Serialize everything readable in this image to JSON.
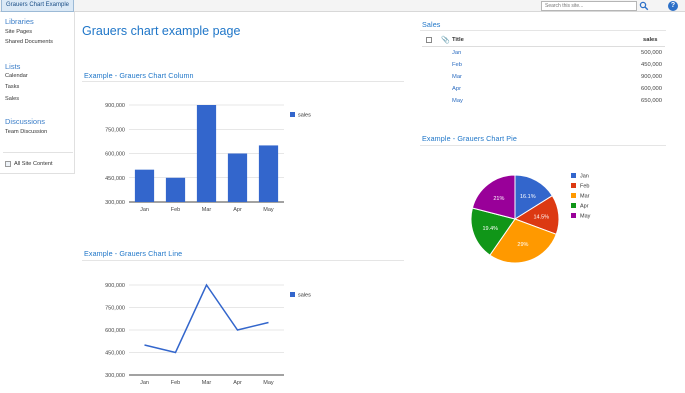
{
  "topbar": {
    "site_tab": "Grauers Chart Example",
    "search_placeholder": "Search this site..."
  },
  "leftnav": {
    "libraries_heading": "Libraries",
    "libraries": [
      "Site Pages",
      "Shared Documents"
    ],
    "lists_heading": "Lists",
    "lists": [
      "Calendar",
      "Tasks",
      "Sales"
    ],
    "discussions_heading": "Discussions",
    "discussions": [
      "Team Discussion"
    ],
    "all_content": "All Site Content"
  },
  "page_title": "Grauers chart example page",
  "sections": {
    "column_title": "Example - Grauers Chart Column",
    "line_title": "Example - Grauers Chart Line",
    "sales_title": "Sales",
    "pie_title": "Example - Grauers Chart Pie"
  },
  "sales_list": {
    "columns": {
      "title": "Title",
      "sales": "sales"
    },
    "rows": [
      {
        "title": "Jan",
        "sales": "500,000"
      },
      {
        "title": "Feb",
        "sales": "450,000"
      },
      {
        "title": "Mar",
        "sales": "900,000"
      },
      {
        "title": "Apr",
        "sales": "600,000"
      },
      {
        "title": "May",
        "sales": "650,000"
      }
    ]
  },
  "colors": {
    "accent": "#1f76c8",
    "series": "#3366cc",
    "pie": [
      "#3366cc",
      "#dc3912",
      "#ff9900",
      "#109618",
      "#990099"
    ]
  },
  "chart_data": [
    {
      "type": "bar",
      "categories": [
        "Jan",
        "Feb",
        "Mar",
        "Apr",
        "May"
      ],
      "series": [
        {
          "name": "sales",
          "values": [
            500000,
            450000,
            900000,
            600000,
            650000
          ]
        }
      ],
      "yticks": [
        "300,000",
        "450,000",
        "600,000",
        "750,000",
        "900,000"
      ],
      "ylim": [
        300000,
        900000
      ],
      "legend": "right",
      "grid": true
    },
    {
      "type": "line",
      "categories": [
        "Jan",
        "Feb",
        "Mar",
        "Apr",
        "May"
      ],
      "series": [
        {
          "name": "sales",
          "values": [
            500000,
            450000,
            900000,
            600000,
            650000
          ]
        }
      ],
      "yticks": [
        "300,000",
        "450,000",
        "600,000",
        "750,000",
        "900,000"
      ],
      "ylim": [
        300000,
        900000
      ],
      "legend": "right",
      "grid": true
    },
    {
      "type": "pie",
      "labels": [
        "Jan",
        "Feb",
        "Mar",
        "Apr",
        "May"
      ],
      "values": [
        500000,
        450000,
        900000,
        600000,
        650000
      ],
      "slice_labels": [
        "16.1%",
        "14.5%",
        "29%",
        "19.4%",
        "21%"
      ],
      "legend": "right"
    }
  ]
}
